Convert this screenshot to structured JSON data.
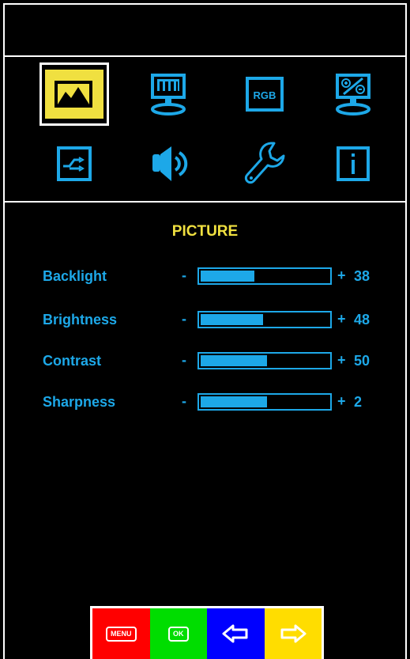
{
  "osd": {
    "section_title": "PICTURE",
    "menu_icons": [
      {
        "name": "picture-icon",
        "selected": true
      },
      {
        "name": "display-icon",
        "selected": false
      },
      {
        "name": "rgb-icon",
        "label": "RGB",
        "selected": false
      },
      {
        "name": "adjust-icon",
        "selected": false
      },
      {
        "name": "input-source-icon",
        "selected": false
      },
      {
        "name": "audio-icon",
        "selected": false
      },
      {
        "name": "wrench-icon",
        "selected": false
      },
      {
        "name": "info-icon",
        "selected": false
      }
    ],
    "settings": [
      {
        "label": "Backlight",
        "value": "38",
        "minus": "-",
        "plus": "+",
        "fill_fraction": 0.42
      },
      {
        "label": "Brightness",
        "value": "48",
        "minus": "-",
        "plus": "+",
        "fill_fraction": 0.49
      },
      {
        "label": "Contrast",
        "value": "50",
        "minus": "-",
        "plus": "+",
        "fill_fraction": 0.52
      },
      {
        "label": "Sharpness",
        "value": "2",
        "minus": "-",
        "plus": "+",
        "fill_fraction": 0.52
      }
    ],
    "buttons": [
      {
        "name": "menu",
        "label": "MENU",
        "color": "#ff0000"
      },
      {
        "name": "ok",
        "label": "OK",
        "color": "#00dd00"
      },
      {
        "name": "left-arrow",
        "color": "#0000ff"
      },
      {
        "name": "right-arrow",
        "color": "#ffdd00"
      }
    ],
    "colors": {
      "accent": "#1da8e8",
      "highlight": "#f0e040",
      "selected_icon_bg": "#f0e040",
      "border": "#ffffff"
    }
  }
}
